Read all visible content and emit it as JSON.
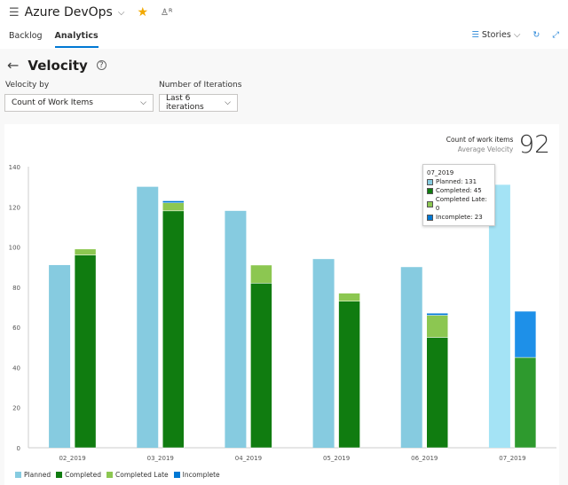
{
  "header": {
    "project": "Azure DevOps",
    "tabs": [
      "Backlog",
      "Analytics"
    ],
    "active_tab": "Analytics",
    "stories_label": "Stories"
  },
  "page": {
    "title": "Velocity"
  },
  "filters": {
    "velocity_by_label": "Velocity by",
    "velocity_by_value": "Count of Work Items",
    "iterations_label": "Number of Iterations",
    "iterations_value": "Last 6 iterations"
  },
  "kpi": {
    "label": "Count of work items",
    "sublabel": "Average Velocity",
    "value": "92"
  },
  "tooltip": {
    "title": "07_2019",
    "rows": [
      "Planned: 131",
      "Completed: 45",
      "Completed Late: 0",
      "Incomplete: 23"
    ]
  },
  "chart_data": {
    "type": "bar",
    "categories": [
      "02_2019",
      "03_2019",
      "04_2019",
      "05_2019",
      "06_2019",
      "07_2019"
    ],
    "series": [
      {
        "name": "Planned",
        "color": "#86cbe0",
        "values": [
          91,
          130,
          118,
          94,
          90,
          131
        ]
      },
      {
        "name": "Completed",
        "color": "#107c10",
        "values": [
          96,
          118,
          82,
          73,
          55,
          45
        ]
      },
      {
        "name": "Completed Late",
        "color": "#8cc751",
        "values": [
          3,
          4,
          9,
          4,
          11,
          0
        ]
      },
      {
        "name": "Incomplete",
        "color": "#0078d4",
        "values": [
          0,
          1,
          0,
          0,
          1,
          23
        ]
      }
    ],
    "ylim": [
      0,
      140
    ],
    "yticks": [
      "0",
      "20",
      "40",
      "60",
      "80",
      "100",
      "120",
      "140"
    ],
    "legend": "bottom-left",
    "grid": false,
    "stacked_series": [
      "Completed",
      "Completed Late",
      "Incomplete"
    ],
    "highlighted_category": "07_2019"
  }
}
